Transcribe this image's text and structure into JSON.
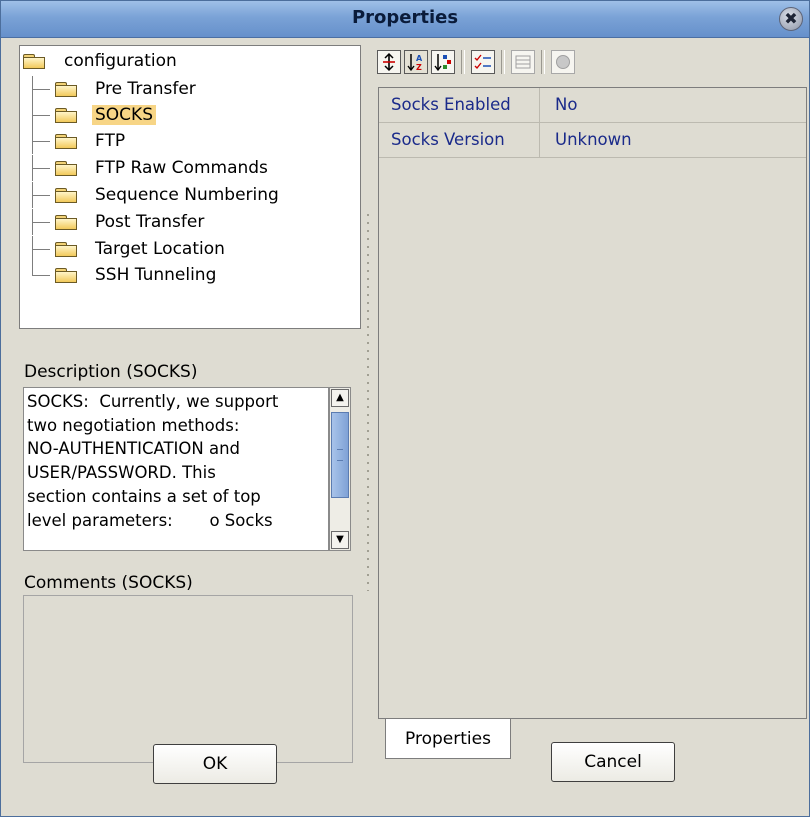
{
  "window": {
    "title": "Properties",
    "close_glyph": "✖"
  },
  "tree": {
    "root": "configuration",
    "items": [
      {
        "label": "Pre Transfer"
      },
      {
        "label": "SOCKS",
        "selected": true
      },
      {
        "label": "FTP"
      },
      {
        "label": "FTP Raw Commands"
      },
      {
        "label": "Sequence Numbering"
      },
      {
        "label": "Post Transfer"
      },
      {
        "label": "Target Location"
      },
      {
        "label": "SSH Tunneling"
      }
    ]
  },
  "description": {
    "label": "Description (SOCKS)",
    "text": "SOCKS:  Currently, we support\ntwo negotiation methods:\nNO-AUTHENTICATION and\nUSER/PASSWORD. This\nsection contains a set of top\nlevel parameters:       o Socks"
  },
  "comments": {
    "label": "Comments (SOCKS)",
    "value": ""
  },
  "toolbar": {
    "icons": [
      "expand-all-icon",
      "sort-alphabetical-icon",
      "sort-category-icon",
      "checklist-icon",
      "grid-icon",
      "help-icon"
    ]
  },
  "properties": {
    "rows": [
      {
        "key": "Socks Enabled",
        "value": "No"
      },
      {
        "key": "Socks Version",
        "value": "Unknown"
      }
    ],
    "tab_label": "Properties"
  },
  "buttons": {
    "ok": "OK",
    "cancel": "Cancel"
  },
  "colors": {
    "selected_bg": "#f7d586",
    "property_text": "#1a2a8a",
    "titlebar": "#7aa2d6"
  }
}
